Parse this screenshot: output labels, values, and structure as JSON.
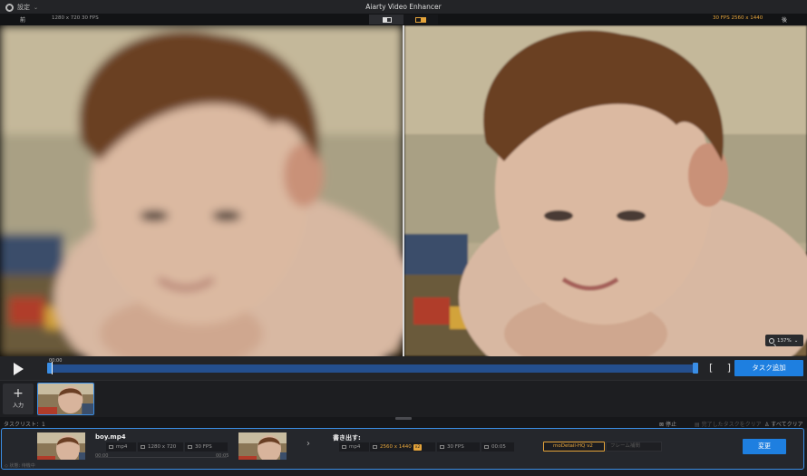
{
  "app": {
    "title": "Aiarty Video Enhancer",
    "settings_label": "設定"
  },
  "viewbar": {
    "left_label": "前",
    "left_info": "1280 x 720  30 FPS",
    "right_info": "30 FPS  2560 x 1440",
    "right_label": "後"
  },
  "viewer": {
    "zoom": "137%"
  },
  "timeline": {
    "timecode": "00:00",
    "add_task": "タスク追加",
    "progress": 0.0
  },
  "input": {
    "label": "入力"
  },
  "tasklist": {
    "title": "タスクリスト：1",
    "stop": "停止",
    "clear_completed": "完了したタスクをクリア",
    "clear_all": "すべてクリア"
  },
  "task": {
    "filename": "boy.mp4",
    "src_format": "mp4",
    "src_resolution": "1280 x 720",
    "src_fps": "30 FPS",
    "time_start": "00:00",
    "time_end": "00:05",
    "export_label": "書き出す:",
    "out_format": "mp4",
    "out_resolution": "2560 x 1440",
    "out_scale": "x2",
    "out_fps": "30 FPS",
    "out_duration": "00:05",
    "model": "moDetail-HQ  v2",
    "frame_placeholder": "フレーム補間",
    "convert": "変更",
    "status": "状態: 待機中"
  },
  "colors": {
    "accent": "#1e7fe0",
    "orange": "#e5a43a"
  }
}
